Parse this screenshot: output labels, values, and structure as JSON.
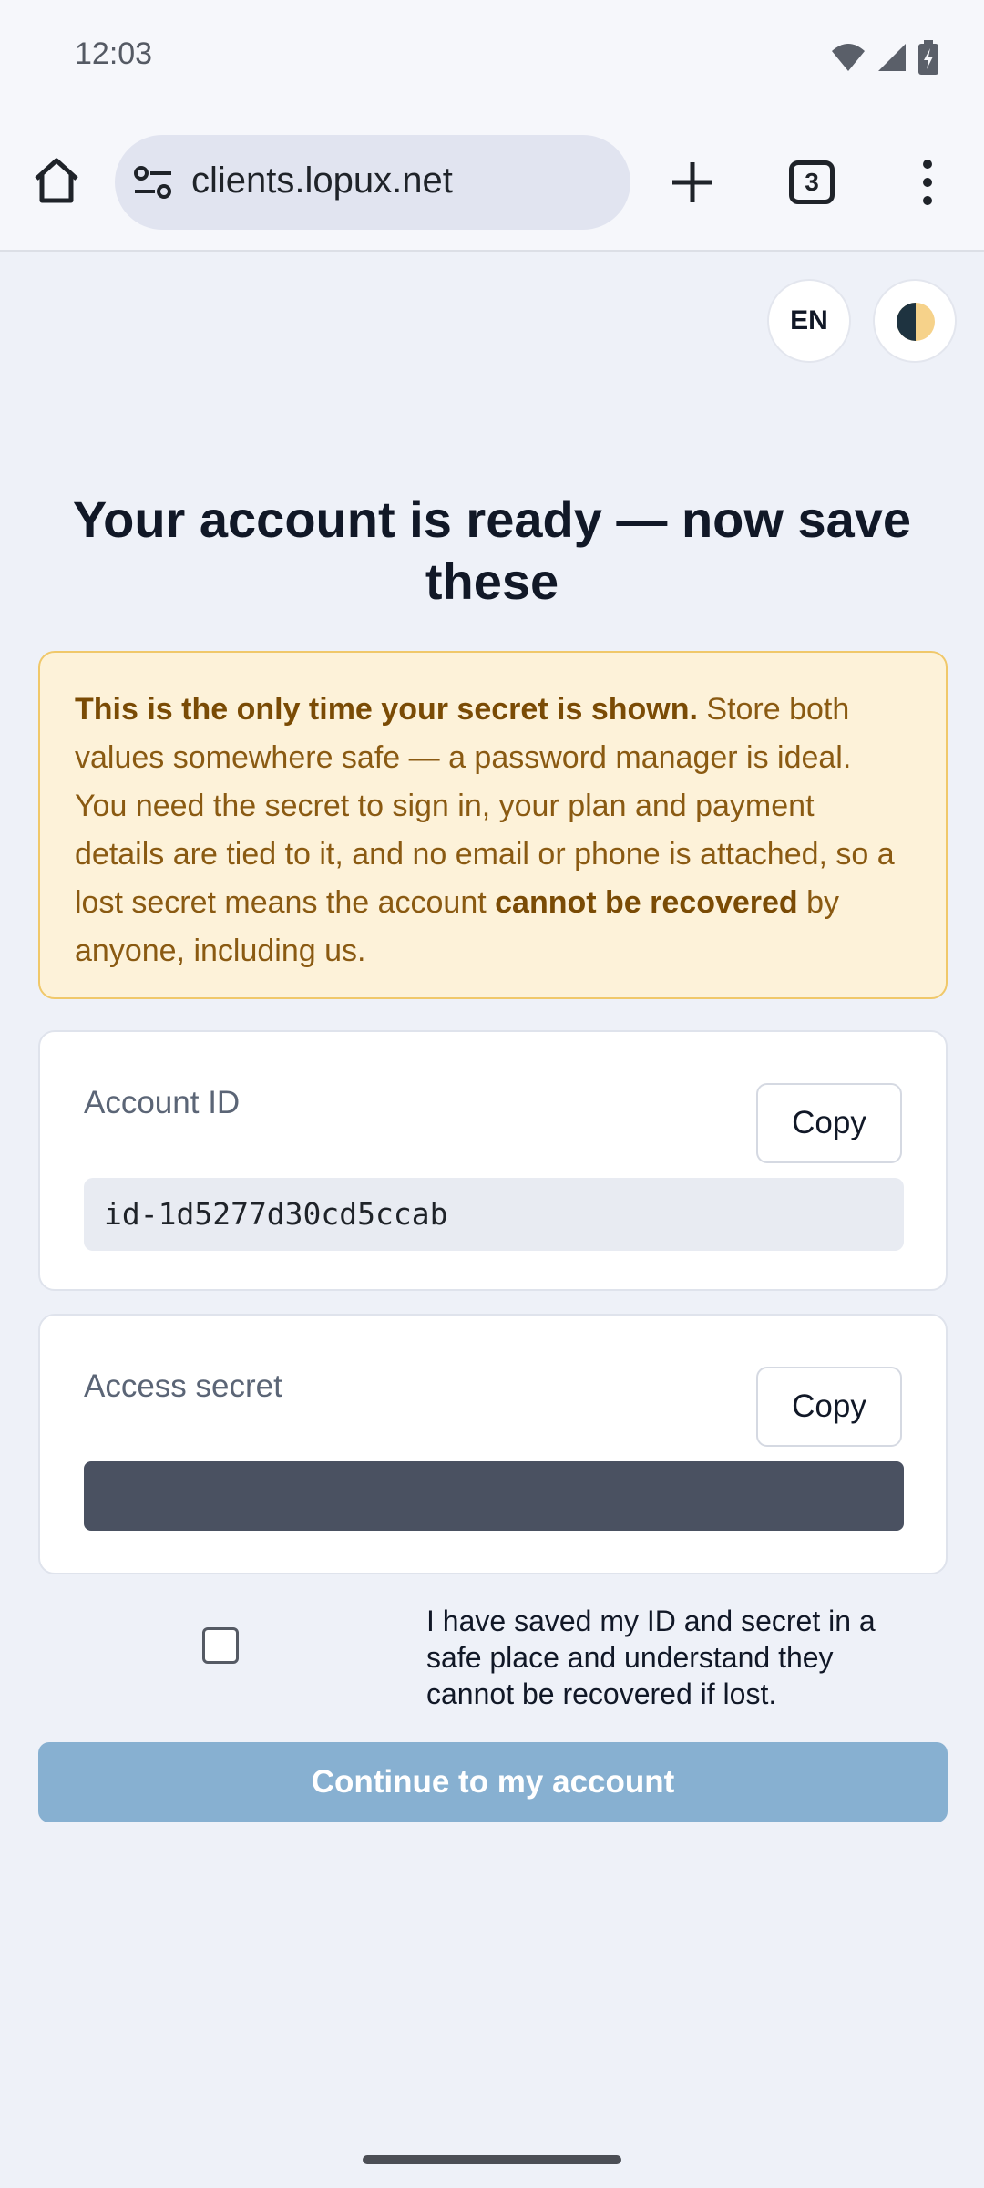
{
  "status_bar": {
    "time": "12:03",
    "icons": [
      "wifi-icon",
      "signal-icon",
      "battery-charging-icon"
    ]
  },
  "browser": {
    "url": "clients.lopux.net",
    "tab_count": "3"
  },
  "header": {
    "language": "EN"
  },
  "main": {
    "title": "Your account is ready — now save these",
    "warning": {
      "lead": "This is the only time your secret is shown.",
      "body_1": " Store both values somewhere safe — a password manager is ideal. You need the secret to sign in, your plan and payment details are tied to it, and no email or phone is attached, so a lost secret means the account ",
      "emphasis": "cannot be recovered",
      "body_2": " by anyone, including us."
    },
    "account_id": {
      "label": "Account ID",
      "copy_label": "Copy",
      "value": "id-1d5277d30cd5ccab"
    },
    "access_secret": {
      "label": "Access secret",
      "copy_label": "Copy"
    },
    "acknowledgement": {
      "text": "I have saved my ID and secret in a safe place and understand they cannot be recovered if lost.",
      "checked": false
    },
    "continue_label": "Continue to my account"
  },
  "colors": {
    "warning_bg": "#fdf2d9",
    "warning_text": "#8a5a12",
    "continue_disabled": "#87b0d1",
    "secret_mask": "#4a5161"
  }
}
